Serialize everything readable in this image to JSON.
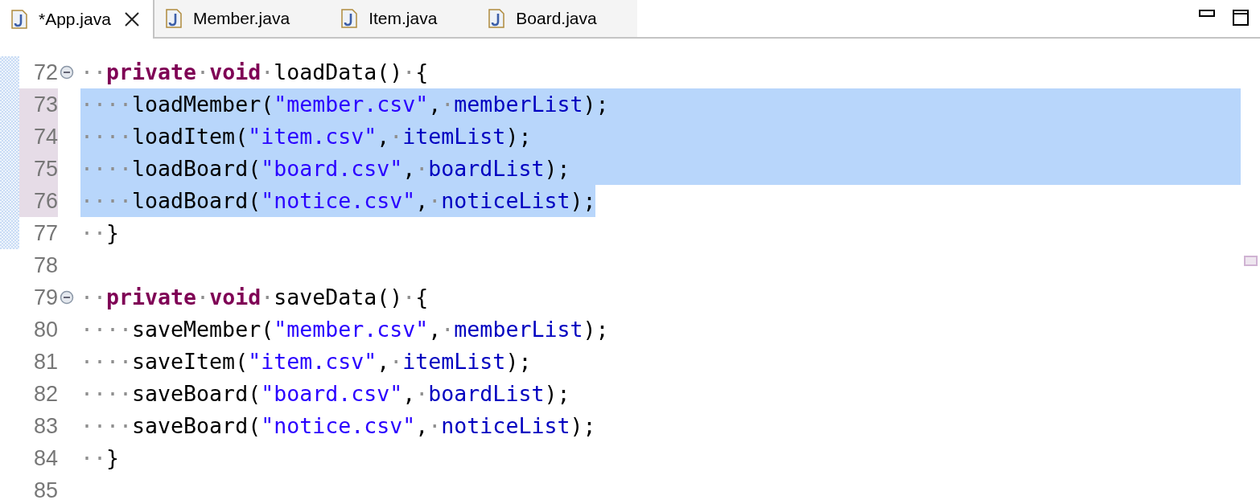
{
  "tabs": [
    {
      "label": "*App.java",
      "selected": true
    },
    {
      "label": "Member.java",
      "selected": false
    },
    {
      "label": "Item.java",
      "selected": false
    },
    {
      "label": "Board.java",
      "selected": false
    }
  ],
  "lines": [
    {
      "number": "72",
      "selected": false,
      "changed": true,
      "fold": true,
      "tokens": [
        {
          "kind": "ws",
          "text": "··"
        },
        {
          "kind": "keyword",
          "text": "private"
        },
        {
          "kind": "ws",
          "text": "·"
        },
        {
          "kind": "keyword",
          "text": "void"
        },
        {
          "kind": "ws",
          "text": "·"
        },
        {
          "kind": "plain",
          "text": "loadData()"
        },
        {
          "kind": "ws",
          "text": "·"
        },
        {
          "kind": "plain",
          "text": "{"
        }
      ]
    },
    {
      "number": "73",
      "selected": true,
      "changed": true,
      "fold": false,
      "tokens": [
        {
          "kind": "ws",
          "text": "····"
        },
        {
          "kind": "plain",
          "text": "loadMember("
        },
        {
          "kind": "string",
          "text": "\"member.csv\""
        },
        {
          "kind": "plain",
          "text": ","
        },
        {
          "kind": "ws",
          "text": "·"
        },
        {
          "kind": "field",
          "text": "memberList"
        },
        {
          "kind": "plain",
          "text": ");"
        }
      ]
    },
    {
      "number": "74",
      "selected": true,
      "changed": true,
      "fold": false,
      "tokens": [
        {
          "kind": "ws",
          "text": "····"
        },
        {
          "kind": "plain",
          "text": "loadItem("
        },
        {
          "kind": "string",
          "text": "\"item.csv\""
        },
        {
          "kind": "plain",
          "text": ","
        },
        {
          "kind": "ws",
          "text": "·"
        },
        {
          "kind": "field",
          "text": "itemList"
        },
        {
          "kind": "plain",
          "text": ");"
        }
      ]
    },
    {
      "number": "75",
      "selected": true,
      "changed": true,
      "fold": false,
      "tokens": [
        {
          "kind": "ws",
          "text": "····"
        },
        {
          "kind": "plain",
          "text": "loadBoard("
        },
        {
          "kind": "string",
          "text": "\"board.csv\""
        },
        {
          "kind": "plain",
          "text": ","
        },
        {
          "kind": "ws",
          "text": "·"
        },
        {
          "kind": "field",
          "text": "boardList"
        },
        {
          "kind": "plain",
          "text": ");"
        }
      ]
    },
    {
      "number": "76",
      "selected": true,
      "changed": true,
      "fold": false,
      "tokens": [
        {
          "kind": "ws",
          "text": "····"
        },
        {
          "kind": "plain",
          "text": "loadBoard("
        },
        {
          "kind": "string",
          "text": "\"notice.csv\""
        },
        {
          "kind": "plain",
          "text": ","
        },
        {
          "kind": "ws",
          "text": "·"
        },
        {
          "kind": "field",
          "text": "noticeList"
        },
        {
          "kind": "plain",
          "text": ");"
        }
      ]
    },
    {
      "number": "77",
      "selected": false,
      "changed": true,
      "fold": false,
      "tokens": [
        {
          "kind": "ws",
          "text": "··"
        },
        {
          "kind": "plain",
          "text": "}"
        }
      ]
    },
    {
      "number": "78",
      "selected": false,
      "changed": false,
      "fold": false
    },
    {
      "number": "79",
      "selected": false,
      "changed": false,
      "fold": true,
      "tokens": [
        {
          "kind": "ws",
          "text": "··"
        },
        {
          "kind": "keyword",
          "text": "private"
        },
        {
          "kind": "ws",
          "text": "·"
        },
        {
          "kind": "keyword",
          "text": "void"
        },
        {
          "kind": "ws",
          "text": "·"
        },
        {
          "kind": "plain",
          "text": "saveData()"
        },
        {
          "kind": "ws",
          "text": "·"
        },
        {
          "kind": "plain",
          "text": "{"
        }
      ]
    },
    {
      "number": "80",
      "selected": false,
      "changed": false,
      "fold": false,
      "tokens": [
        {
          "kind": "ws",
          "text": "····"
        },
        {
          "kind": "plain",
          "text": "saveMember("
        },
        {
          "kind": "string",
          "text": "\"member.csv\""
        },
        {
          "kind": "plain",
          "text": ","
        },
        {
          "kind": "ws",
          "text": "·"
        },
        {
          "kind": "field",
          "text": "memberList"
        },
        {
          "kind": "plain",
          "text": ");"
        }
      ]
    },
    {
      "number": "81",
      "selected": false,
      "changed": false,
      "fold": false,
      "tokens": [
        {
          "kind": "ws",
          "text": "····"
        },
        {
          "kind": "plain",
          "text": "saveItem("
        },
        {
          "kind": "string",
          "text": "\"item.csv\""
        },
        {
          "kind": "plain",
          "text": ","
        },
        {
          "kind": "ws",
          "text": "·"
        },
        {
          "kind": "field",
          "text": "itemList"
        },
        {
          "kind": "plain",
          "text": ");"
        }
      ]
    },
    {
      "number": "82",
      "selected": false,
      "changed": false,
      "fold": false,
      "tokens": [
        {
          "kind": "ws",
          "text": "····"
        },
        {
          "kind": "plain",
          "text": "saveBoard("
        },
        {
          "kind": "string",
          "text": "\"board.csv\""
        },
        {
          "kind": "plain",
          "text": ","
        },
        {
          "kind": "ws",
          "text": "·"
        },
        {
          "kind": "field",
          "text": "boardList"
        },
        {
          "kind": "plain",
          "text": ");"
        }
      ]
    },
    {
      "number": "83",
      "selected": false,
      "changed": false,
      "fold": false,
      "tokens": [
        {
          "kind": "ws",
          "text": "····"
        },
        {
          "kind": "plain",
          "text": "saveBoard("
        },
        {
          "kind": "string",
          "text": "\"notice.csv\""
        },
        {
          "kind": "plain",
          "text": ","
        },
        {
          "kind": "ws",
          "text": "·"
        },
        {
          "kind": "field",
          "text": "noticeList"
        },
        {
          "kind": "plain",
          "text": ");"
        }
      ]
    },
    {
      "number": "84",
      "selected": false,
      "changed": false,
      "fold": false,
      "tokens": [
        {
          "kind": "ws",
          "text": "··"
        },
        {
          "kind": "plain",
          "text": "}"
        }
      ]
    },
    {
      "number": "85",
      "selected": false,
      "changed": false,
      "fold": false
    }
  ]
}
